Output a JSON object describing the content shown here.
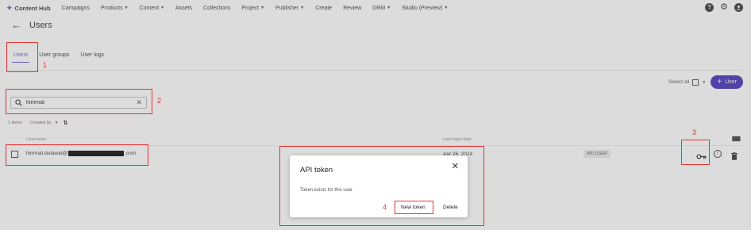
{
  "nav": {
    "brand": "Content Hub",
    "items": [
      {
        "label": "Campaigns",
        "caret": false
      },
      {
        "label": "Products",
        "caret": true
      },
      {
        "label": "Content",
        "caret": true
      },
      {
        "label": "Assets",
        "caret": false
      },
      {
        "label": "Collections",
        "caret": false
      },
      {
        "label": "Project",
        "caret": true
      },
      {
        "label": "Publisher",
        "caret": true
      },
      {
        "label": "Create",
        "caret": false
      },
      {
        "label": "Review",
        "caret": false
      },
      {
        "label": "DRM",
        "caret": true
      },
      {
        "label": "Studio (Preview)",
        "caret": true
      }
    ],
    "help_glyph": "?"
  },
  "header": {
    "title": "Users"
  },
  "tabs": [
    {
      "label": "Users",
      "active": true
    },
    {
      "label": "User groups",
      "active": false
    },
    {
      "label": "User logs",
      "active": false
    }
  ],
  "actions": {
    "select_all": "Select all",
    "add_user": "User"
  },
  "search": {
    "value": "himmat",
    "placeholder": ""
  },
  "meta": {
    "count": "1 items",
    "created_by": "Created by"
  },
  "table": {
    "col_username": "Username",
    "col_last_login": "Last login date",
    "rows": [
      {
        "username_prefix": "himmat.dulawat@",
        "username_suffix": ".com",
        "last_login": "Apr 26, 2024",
        "badge": "API USER"
      }
    ]
  },
  "dialog": {
    "title": "API token",
    "text": "Token exists for this user",
    "new_token": "New token",
    "delete": "Delete"
  },
  "annotations": [
    "1",
    "2",
    "3",
    "4"
  ],
  "colors": {
    "accent": "#5b4fd6",
    "button": "#3d2bb3",
    "annotation": "#e53333"
  }
}
